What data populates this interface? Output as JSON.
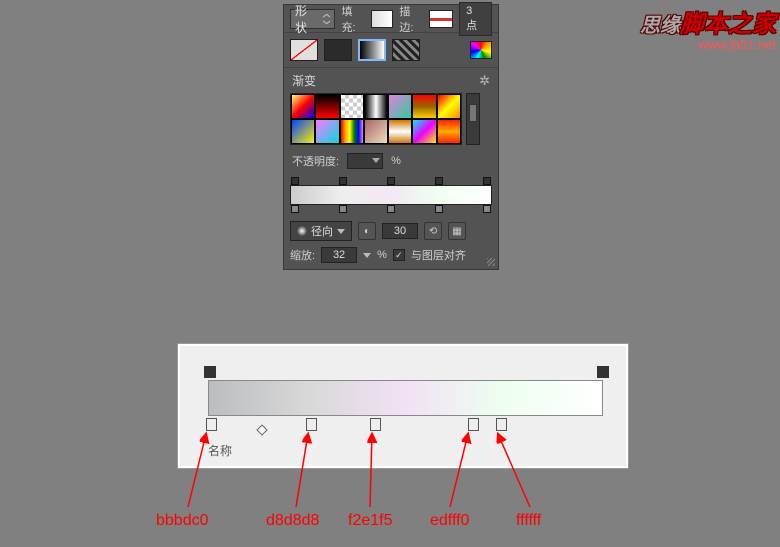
{
  "watermark": {
    "prefix": "思缘",
    "title": "脚本之家",
    "url": "www.jb51.net"
  },
  "topbar": {
    "shape": "形状",
    "fill": "填充:",
    "stroke": "描边:",
    "size": "3 点"
  },
  "section": {
    "gradient": "渐变",
    "gear": "✲"
  },
  "opacity": {
    "label": "不透明度:",
    "pct": "%"
  },
  "type": {
    "radial": "径向",
    "angle": "30"
  },
  "scale": {
    "label": "缩放:",
    "value": "32",
    "pct": "%",
    "align": "与图层对齐",
    "checked": "✓"
  },
  "gedit": {
    "section": "名称"
  },
  "colors": {
    "c1": "bbbdc0",
    "c2": "d8d8d8",
    "c3": "f2e1f5",
    "c4": "edfff0",
    "c5": "ffffff"
  }
}
